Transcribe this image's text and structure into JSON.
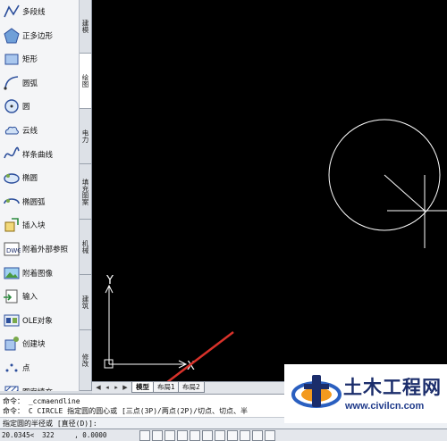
{
  "palette": {
    "items": [
      {
        "label": "多段线",
        "icon": "polyline-icon"
      },
      {
        "label": "正多边形",
        "icon": "polygon-icon"
      },
      {
        "label": "矩形",
        "icon": "rectangle-icon"
      },
      {
        "label": "圆弧",
        "icon": "arc-icon"
      },
      {
        "label": "圆",
        "icon": "circle-icon"
      },
      {
        "label": "云线",
        "icon": "revcloud-icon"
      },
      {
        "label": "样条曲线",
        "icon": "spline-icon"
      },
      {
        "label": "椭圆",
        "icon": "ellipse-icon"
      },
      {
        "label": "椭圆弧",
        "icon": "elliptical-arc-icon"
      },
      {
        "label": "插入块",
        "icon": "insert-block-icon"
      },
      {
        "label": "附着外部参照",
        "icon": "xref-attach-icon"
      },
      {
        "label": "附着图像",
        "icon": "image-attach-icon"
      },
      {
        "label": "输入",
        "icon": "import-icon"
      },
      {
        "label": "OLE对象",
        "icon": "ole-object-icon"
      },
      {
        "label": "创建块",
        "icon": "create-block-icon"
      },
      {
        "label": "点",
        "icon": "point-icon"
      },
      {
        "label": "图案填充",
        "icon": "hatch-icon"
      }
    ]
  },
  "vertical_tabs": [
    {
      "label": "建模",
      "active": false
    },
    {
      "label": "绘图",
      "active": true
    },
    {
      "label": "电力",
      "active": false
    },
    {
      "label": "填充图案",
      "active": false
    },
    {
      "label": "机械",
      "active": false
    },
    {
      "label": "建筑",
      "active": false
    },
    {
      "label": "修改",
      "active": false
    }
  ],
  "canvas": {
    "ucs_x_label": "X",
    "ucs_y_label": "Y",
    "background": "#000000",
    "stroke": "#ffffff",
    "arrow_color": "#d9322a"
  },
  "layout_tabs": [
    {
      "label": "模型",
      "active": true
    },
    {
      "label": "布局1",
      "active": false
    },
    {
      "label": "布局2",
      "active": false
    }
  ],
  "command": {
    "history": [
      "命令：  _ccmaendline",
      "命令：  C CIRCLE 指定圆的圆心或 [三点(3P)/两点(2P)/切点、切点、半"
    ],
    "prompt": "指定圆的半径或 [直径(D)]:"
  },
  "status": {
    "coords": "20.0345<  322     , 0.0000"
  },
  "watermark": {
    "name": "土木工程网",
    "url": "www.civilcn.com"
  }
}
